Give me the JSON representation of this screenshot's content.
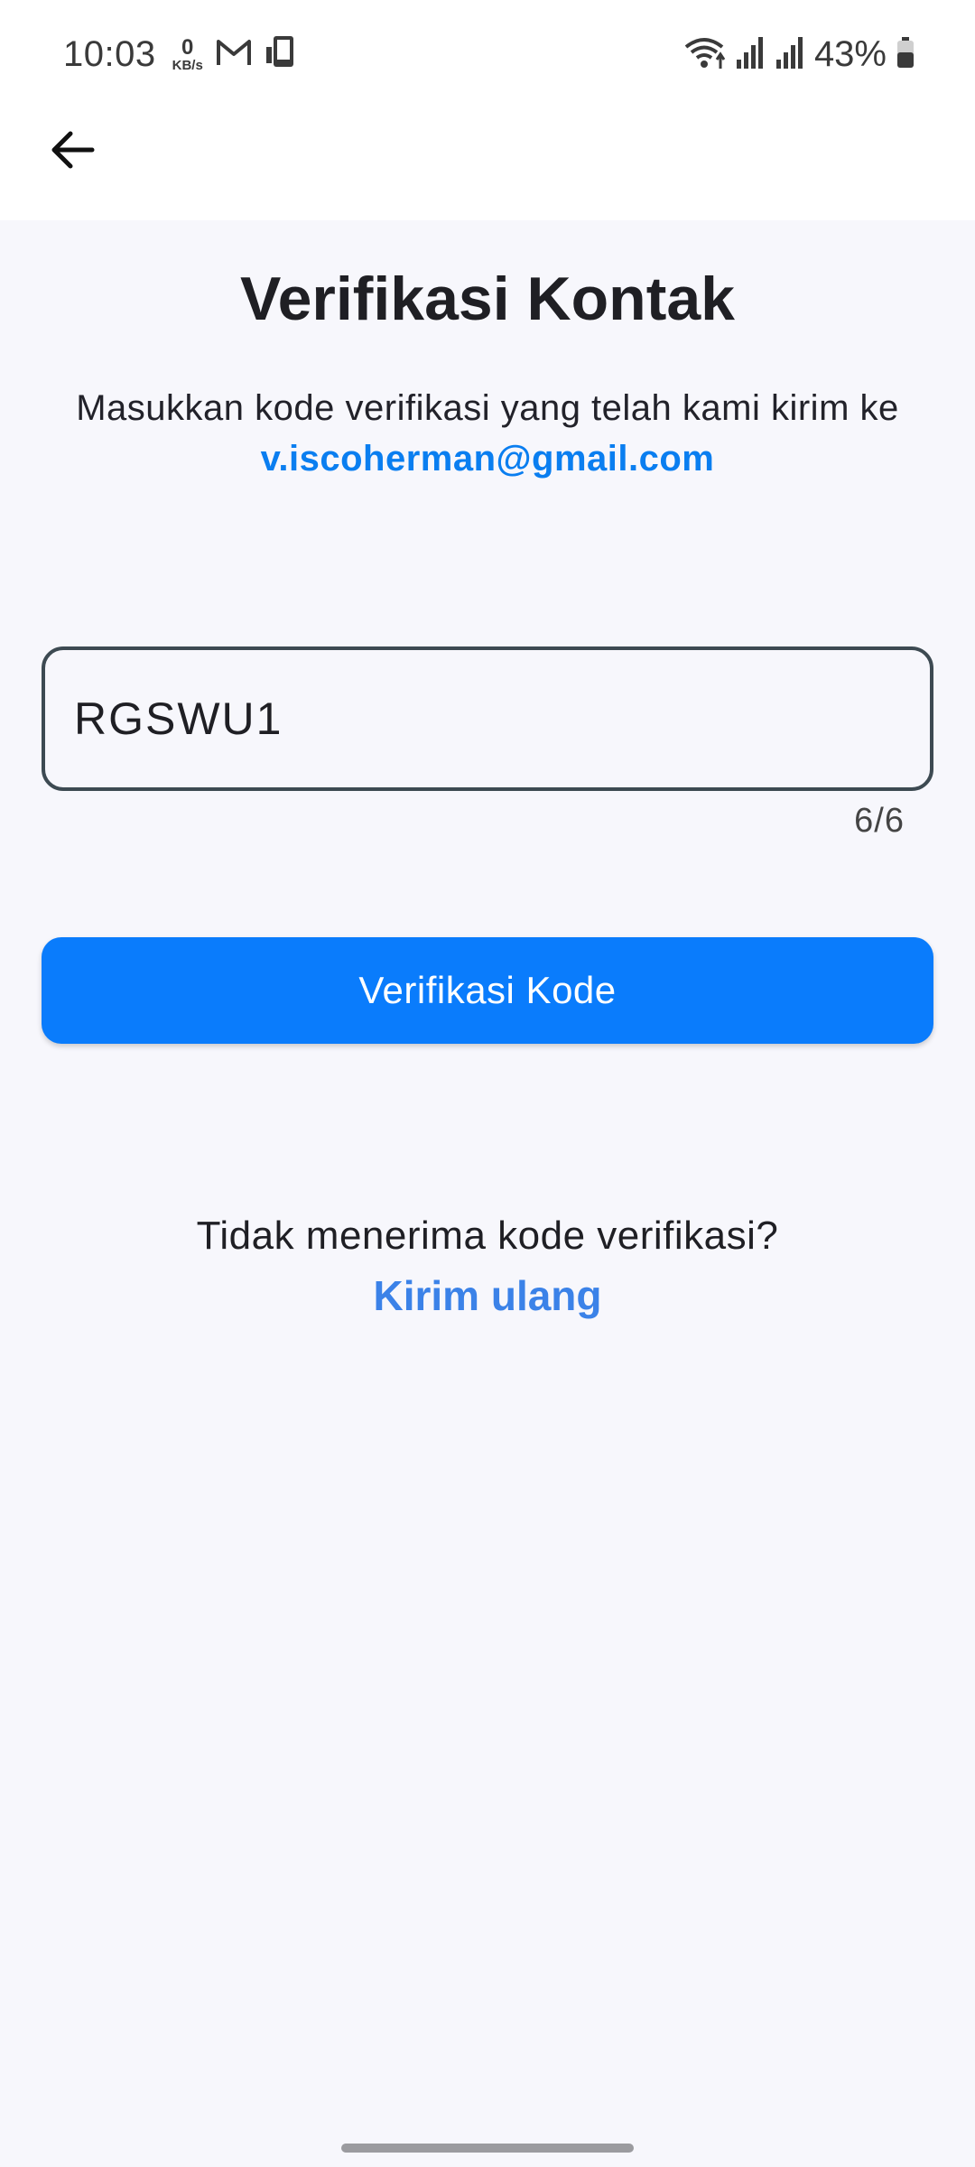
{
  "status_bar": {
    "time": "10:03",
    "net_speed_value": "0",
    "net_speed_unit": "KB/s",
    "battery_percent": "43%",
    "icons": [
      "gmail-icon",
      "device-icon",
      "wifi-icon",
      "signal-icon",
      "signal-icon",
      "battery-icon"
    ]
  },
  "app_bar": {
    "back_icon": "arrow-left-icon"
  },
  "main": {
    "title": "Verifikasi Kontak",
    "subtitle_prefix": "Masukkan kode verifikasi yang telah kami kirim ke ",
    "email": "v.iscoherman@gmail.com",
    "code_value": "RGSWU1",
    "counter": "6/6",
    "verify_label": "Verifikasi Kode",
    "resend_question": "Tidak menerima kode verifikasi?",
    "resend_label": "Kirim ulang"
  },
  "colors": {
    "accent": "#0a7cfc",
    "link": "#3b82e8",
    "background": "#f7f7fc"
  }
}
